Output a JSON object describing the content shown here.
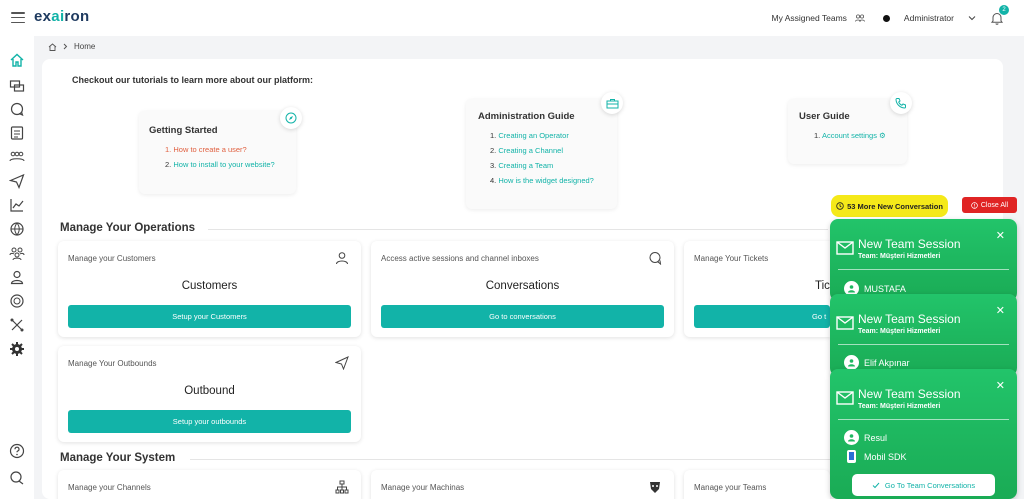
{
  "app": {
    "logo": "exairon"
  },
  "topbar": {
    "assigned_teams": "My Assigned Teams",
    "user": "Administrator",
    "notification_count": "2"
  },
  "breadcrumb": {
    "home": "Home"
  },
  "intro": "Checkout our tutorials to learn more about our platform:",
  "guides": {
    "getting_started": {
      "title": "Getting Started",
      "items": [
        {
          "n": "1.",
          "t": "How to create a user?"
        },
        {
          "n": "2.",
          "t": "How to install to your website?"
        }
      ]
    },
    "admin": {
      "title": "Administration Guide",
      "items": [
        {
          "n": "1.",
          "t": "Creating an Operator"
        },
        {
          "n": "2.",
          "t": "Creating a Channel"
        },
        {
          "n": "3.",
          "t": "Creating a Team"
        },
        {
          "n": "4.",
          "t": "How is the widget designed?"
        }
      ]
    },
    "user": {
      "title": "User Guide",
      "items": [
        {
          "n": "1.",
          "t": "Account settings"
        }
      ]
    }
  },
  "operations": {
    "title": "Manage Your Operations",
    "cards": [
      {
        "sub": "Manage your Customers",
        "title": "Customers",
        "button": "Setup your Customers"
      },
      {
        "sub": "Access active sessions and channel inboxes",
        "title": "Conversations",
        "button": "Go to conversations"
      },
      {
        "sub": "Manage Your Tickets",
        "title": "Tic",
        "button": "Go t"
      },
      {
        "sub": "Manage Your Outbounds",
        "title": "Outbound",
        "button": "Setup your outbounds"
      }
    ]
  },
  "system": {
    "title": "Manage Your System",
    "cards": [
      {
        "sub": "Manage your Channels"
      },
      {
        "sub": "Manage your Machinas"
      },
      {
        "sub": "Manage your Teams"
      }
    ]
  },
  "alerts": {
    "more_new": "53 More New Conversation",
    "close_all": "Close All"
  },
  "notifications": [
    {
      "title": "New Team Session",
      "team": "Team: Müşteri Hizmetleri",
      "user": "MUSTAFA"
    },
    {
      "title": "New Team Session",
      "team": "Team: Müşteri Hizmetleri",
      "user": "Elif Akpınar"
    },
    {
      "title": "New Team Session",
      "team": "Team: Müşteri Hizmetleri",
      "user": "Resul",
      "channel": "Mobil SDK",
      "button": "Go To Team Conversations"
    }
  ],
  "colors": {
    "accent": "#12b3a8",
    "notification": "#1fb861",
    "alert_yellow": "#f5e919",
    "alert_red": "#e02424"
  }
}
